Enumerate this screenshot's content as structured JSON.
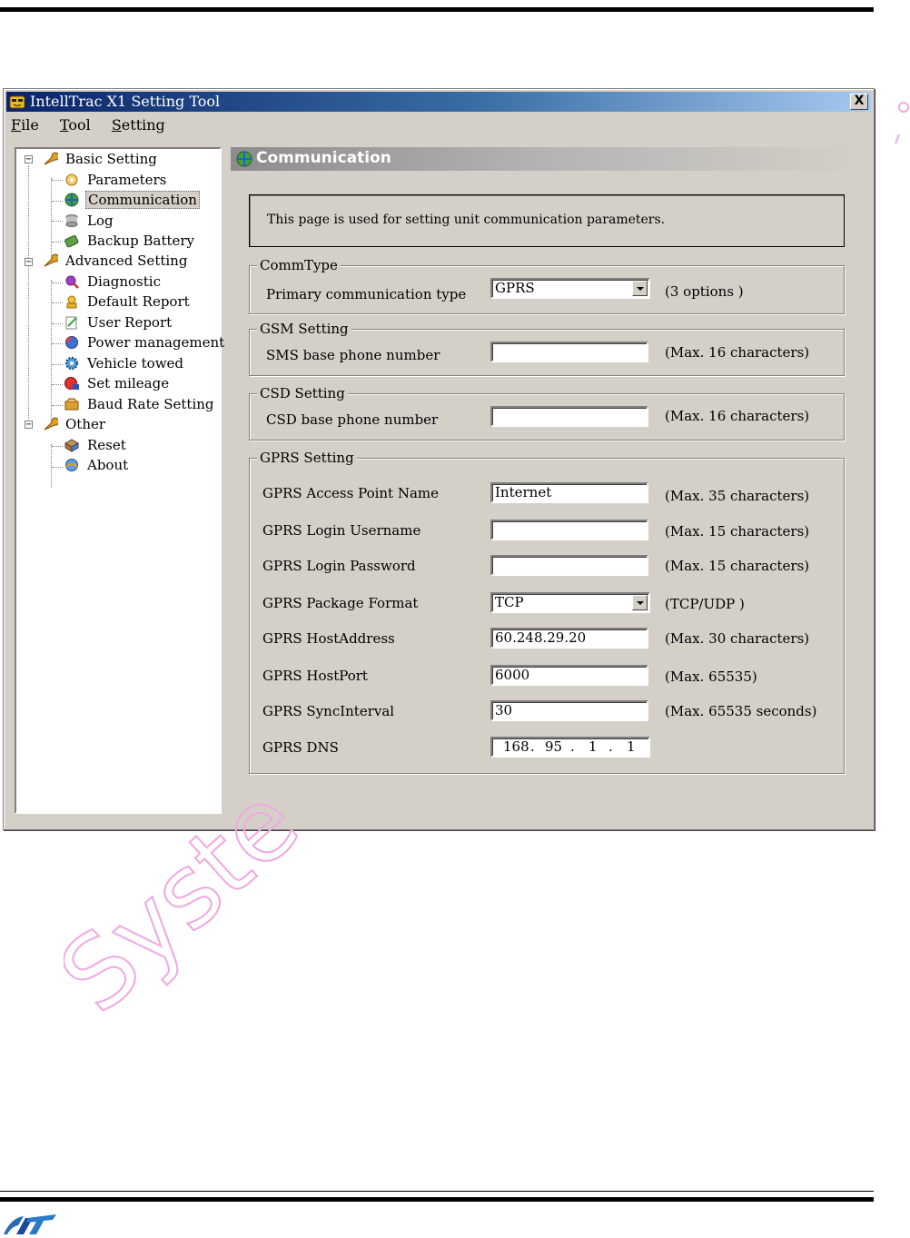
{
  "window": {
    "title": "IntellTrac X1 Setting Tool",
    "close_label": "X"
  },
  "menu": [
    {
      "accel": "F",
      "rest": "ile"
    },
    {
      "accel": "T",
      "rest": "ool"
    },
    {
      "accel": "S",
      "rest": "etting"
    }
  ],
  "tree": {
    "basic": {
      "label": "Basic Setting",
      "children": [
        "Parameters",
        "Communication",
        "Log",
        "Backup Battery"
      ]
    },
    "advanced": {
      "label": "Advanced Setting",
      "children": [
        "Diagnostic",
        "Default Report",
        "User Report",
        "Power management",
        "Vehicle towed",
        "Set mileage",
        "Baud Rate Setting"
      ]
    },
    "other": {
      "label": "Other",
      "children": [
        "Reset",
        "About"
      ]
    },
    "selected": "Communication"
  },
  "panel": {
    "title": "Communication",
    "info": "This page is used for setting unit communication parameters."
  },
  "commtype": {
    "legend": "CommType",
    "label": "Primary communication type",
    "value": "GPRS",
    "hint": "(3 options )"
  },
  "gsm": {
    "legend": "GSM Setting",
    "label": "SMS base phone number",
    "value": "",
    "hint": "(Max. 16 characters)"
  },
  "csd": {
    "legend": "CSD Setting",
    "label": "CSD base phone number",
    "value": "",
    "hint": "(Max. 16 characters)"
  },
  "gprs": {
    "legend": "GPRS Setting",
    "apn": {
      "label": "GPRS Access Point Name",
      "value": "Internet",
      "hint": "(Max. 35 characters)"
    },
    "username": {
      "label": "GPRS Login Username",
      "value": "",
      "hint": "(Max. 15 characters)"
    },
    "password": {
      "label": "GPRS Login Password",
      "value": "",
      "hint": "(Max. 15 characters)"
    },
    "format": {
      "label": "GPRS Package Format",
      "value": "TCP",
      "hint": "(TCP/UDP )"
    },
    "host": {
      "label": "GPRS HostAddress",
      "value": "60.248.29.20",
      "hint": "(Max. 30 characters)"
    },
    "port": {
      "label": "GPRS HostPort",
      "value": "6000",
      "hint": "(Max. 65535)"
    },
    "sync": {
      "label": "GPRS SyncInterval",
      "value": "30",
      "hint": "(Max. 65535 seconds)"
    },
    "dns": {
      "label": "GPRS DNS",
      "octets": [
        "168",
        "95",
        "1",
        "1"
      ],
      "dot": "."
    }
  },
  "watermark": {
    "text": "Syste"
  },
  "colors": {
    "title_gradient_start": "#0a246a",
    "title_gradient_end": "#a6caf0",
    "window_face": "#d4d0c8",
    "watermark": "#f0a8e0"
  }
}
